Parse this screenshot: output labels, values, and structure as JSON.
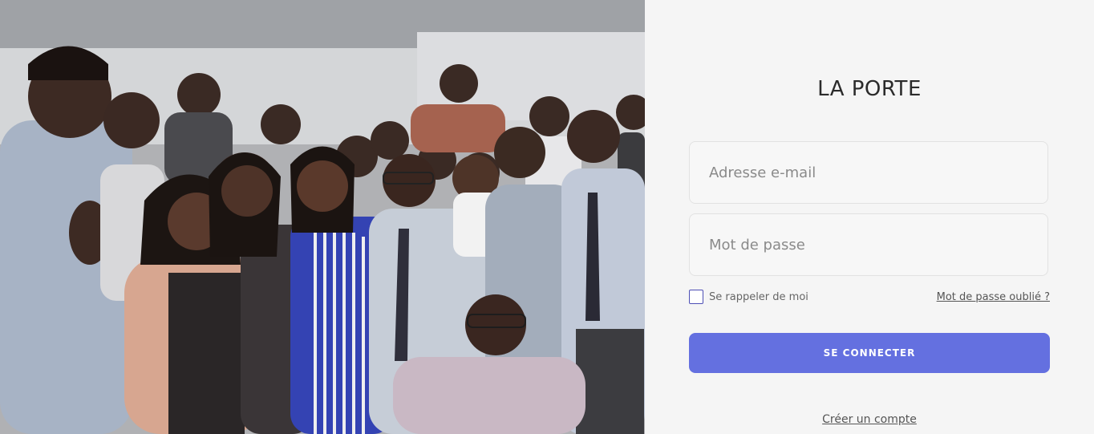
{
  "photo": {
    "description_icon": "group-photo"
  },
  "login": {
    "brand": "LA PORTE",
    "email_placeholder": "Adresse e-mail",
    "password_placeholder": "Mot de passe",
    "remember_label": "Se rappeler de moi",
    "forgot_label": "Mot de passe oublié ?",
    "submit_label": "SE CONNECTER",
    "signup_label": "Créer un compte",
    "accent_color": "#6470e0",
    "checkbox_color": "#4d4fb5"
  }
}
